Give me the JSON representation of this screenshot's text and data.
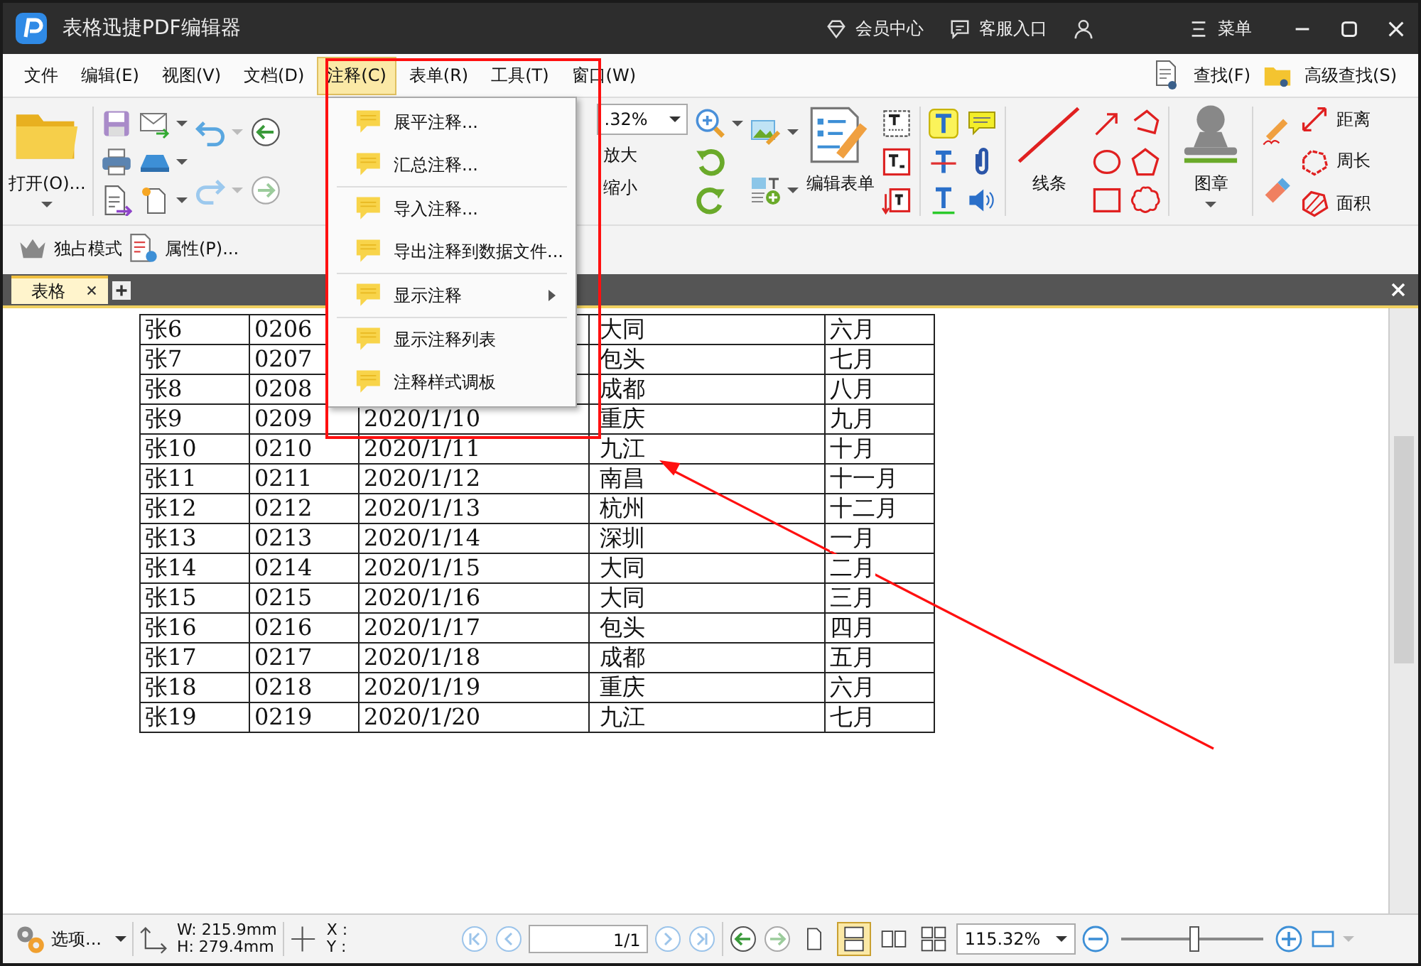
{
  "window": {
    "title": "表格迅捷PDF编辑器"
  },
  "title_bar": {
    "links": [
      "会员中心",
      "客服入口"
    ],
    "menu": "菜单"
  },
  "menu_bar": {
    "items": [
      {
        "label": "文件",
        "selected": false
      },
      {
        "label": "编辑(E)",
        "selected": false
      },
      {
        "label": "视图(V)",
        "selected": false
      },
      {
        "label": "文档(D)",
        "selected": false
      },
      {
        "label": "注释(C)",
        "selected": true
      },
      {
        "label": "表单(R)",
        "selected": false
      },
      {
        "label": "工具(T)",
        "selected": false
      },
      {
        "label": "窗口(W)",
        "selected": false
      }
    ],
    "right": [
      "查找(F)",
      "高级查找(S)"
    ]
  },
  "toolbar": {
    "open": "打开(O)...",
    "zoom_value": ".32%",
    "zoom_in": "放大",
    "zoom_out": "缩小",
    "edit_form": "编辑表单",
    "line": "线条",
    "stamp": "图章",
    "measure": [
      "距离",
      "周长",
      "面积"
    ]
  },
  "toolbar2": [
    "独占模式",
    "属性(P)..."
  ],
  "tabs": [
    {
      "label": "表格",
      "selected": true
    }
  ],
  "table": {
    "rows": [
      {
        "name": "张6",
        "code": "0206",
        "city": "大同",
        "month": "六月"
      },
      {
        "name": "张7",
        "code": "0207",
        "city": "包头",
        "month": "七月"
      },
      {
        "name": "张8",
        "code": "0208",
        "city": "成都",
        "month": "八月"
      },
      {
        "name": "张9",
        "code": "0209",
        "date": "2020/1/10",
        "city": "重庆",
        "month": "九月"
      },
      {
        "name": "张10",
        "code": "0210",
        "date": "2020/1/11",
        "city": "九江",
        "month": "十月"
      },
      {
        "name": "张11",
        "code": "0211",
        "date": "2020/1/12",
        "city": "南昌",
        "month": "十一月"
      },
      {
        "name": "张12",
        "code": "0212",
        "date": "2020/1/13",
        "city": "杭州",
        "month": "十二月"
      },
      {
        "name": "张13",
        "code": "0213",
        "date": "2020/1/14",
        "city": "深圳",
        "month": "一月"
      },
      {
        "name": "张14",
        "code": "0214",
        "date": "2020/1/15",
        "city": "大同",
        "month": "二月"
      },
      {
        "name": "张15",
        "code": "0215",
        "date": "2020/1/16",
        "city": "大同",
        "month": "三月"
      },
      {
        "name": "张16",
        "code": "0216",
        "date": "2020/1/17",
        "city": "包头",
        "month": "四月"
      },
      {
        "name": "张17",
        "code": "0217",
        "date": "2020/1/18",
        "city": "成都",
        "month": "五月"
      },
      {
        "name": "张18",
        "code": "0218",
        "date": "2020/1/19",
        "city": "重庆",
        "month": "六月"
      },
      {
        "name": "张19",
        "code": "0219",
        "date": "2020/1/20",
        "city": "九江",
        "month": "七月"
      }
    ]
  },
  "annotation_menu": {
    "groups": [
      [
        {
          "label": "展平注释...",
          "submenu": false
        },
        {
          "label": "汇总注释...",
          "submenu": false
        }
      ],
      [
        {
          "label": "导入注释...",
          "submenu": false
        },
        {
          "label": "导出注释到数据文件...",
          "submenu": false
        }
      ],
      [
        {
          "label": "显示注释",
          "submenu": true
        }
      ],
      [
        {
          "label": "显示注释列表",
          "submenu": false
        },
        {
          "label": "注释样式调板",
          "submenu": false
        }
      ]
    ]
  },
  "status_bar": {
    "options": "选项...",
    "width": "W: 215.9mm",
    "height": "H: 279.4mm",
    "x": "X :",
    "y": "Y :",
    "page": "1/1",
    "view_modes": [
      {
        "selected": false
      },
      {
        "selected": true
      },
      {
        "selected": false
      },
      {
        "selected": false
      }
    ],
    "zoom": "115.32%",
    "zoom_slider": {
      "level": 0.52
    }
  }
}
